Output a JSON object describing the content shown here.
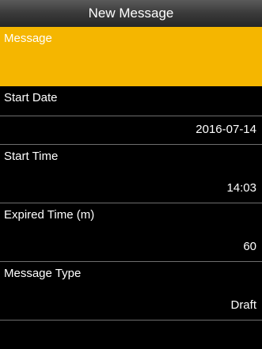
{
  "header": {
    "title": "New Message"
  },
  "items": [
    {
      "label": "Message",
      "value": ""
    },
    {
      "label": "Start Date",
      "value": "2016-07-14"
    },
    {
      "label": "Start Time",
      "value": "14:03"
    },
    {
      "label": "Expired Time (m)",
      "value": "60"
    },
    {
      "label": "Message Type",
      "value": "Draft"
    }
  ]
}
